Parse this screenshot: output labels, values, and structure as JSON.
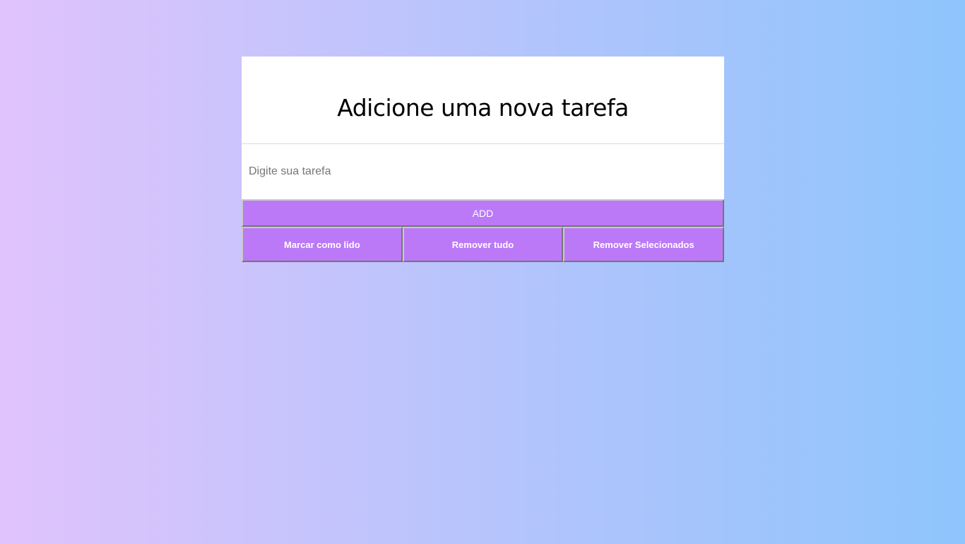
{
  "header": {
    "title": "Adicione uma nova tarefa"
  },
  "task_form": {
    "input_value": "",
    "input_placeholder": "Digite sua tarefa",
    "add_label": "ADD"
  },
  "actions": {
    "mark_read_label": "Marcar como lido",
    "remove_all_label": "Remover tudo",
    "remove_selected_label": "Remover Selecionados"
  },
  "tasks": [],
  "colors": {
    "gradient_start": "#e0c3fc",
    "gradient_end": "#8ec5fc",
    "button": "#bb79f7",
    "card": "#ffffff"
  }
}
